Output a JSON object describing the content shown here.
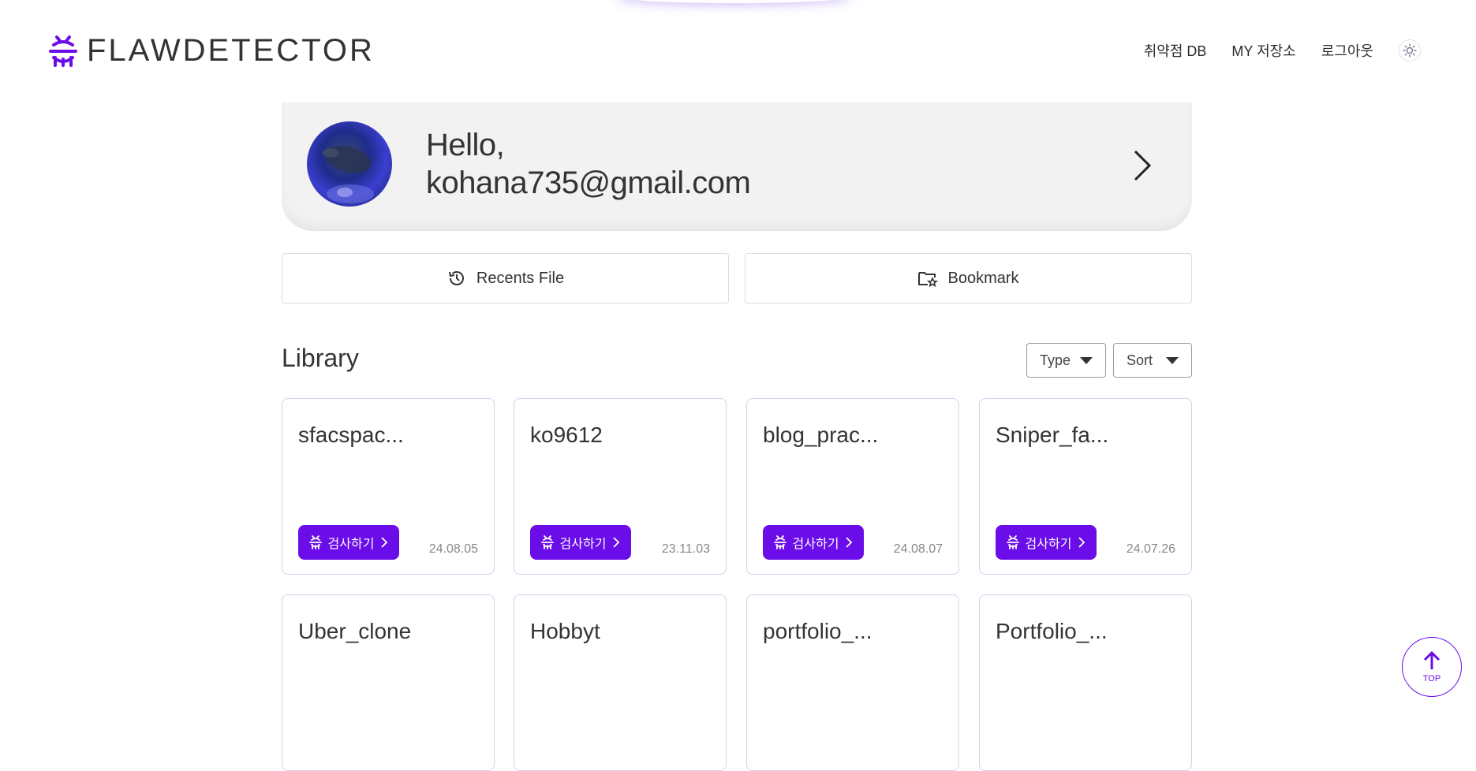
{
  "header": {
    "logo_text": "FLAWDETECTOR",
    "nav": [
      {
        "label": "취약점 DB"
      },
      {
        "label": "MY 저장소"
      },
      {
        "label": "로그아웃"
      }
    ],
    "theme_icon": "sun-icon"
  },
  "profile": {
    "greeting": "Hello,",
    "email": "kohana735@gmail.com"
  },
  "tabs": {
    "recents_label": "Recents File",
    "bookmark_label": "Bookmark"
  },
  "library": {
    "title": "Library",
    "type_filter": "Type",
    "sort_filter": "Sort",
    "scan_label": "검사하기",
    "cards": [
      {
        "title": "sfacspac...",
        "date": "24.08.05"
      },
      {
        "title": "ko9612",
        "date": "23.11.03"
      },
      {
        "title": "blog_prac...",
        "date": "24.08.07"
      },
      {
        "title": "Sniper_fa...",
        "date": "24.07.26"
      },
      {
        "title": "Uber_clone",
        "date": ""
      },
      {
        "title": "Hobbyt",
        "date": ""
      },
      {
        "title": "portfolio_...",
        "date": ""
      },
      {
        "title": "Portfolio_...",
        "date": ""
      }
    ]
  },
  "top_button": {
    "label": "TOP"
  },
  "colors": {
    "accent": "#6a0de8",
    "card_border": "#d4d0f0",
    "profile_bg": "#f2f2f2"
  }
}
